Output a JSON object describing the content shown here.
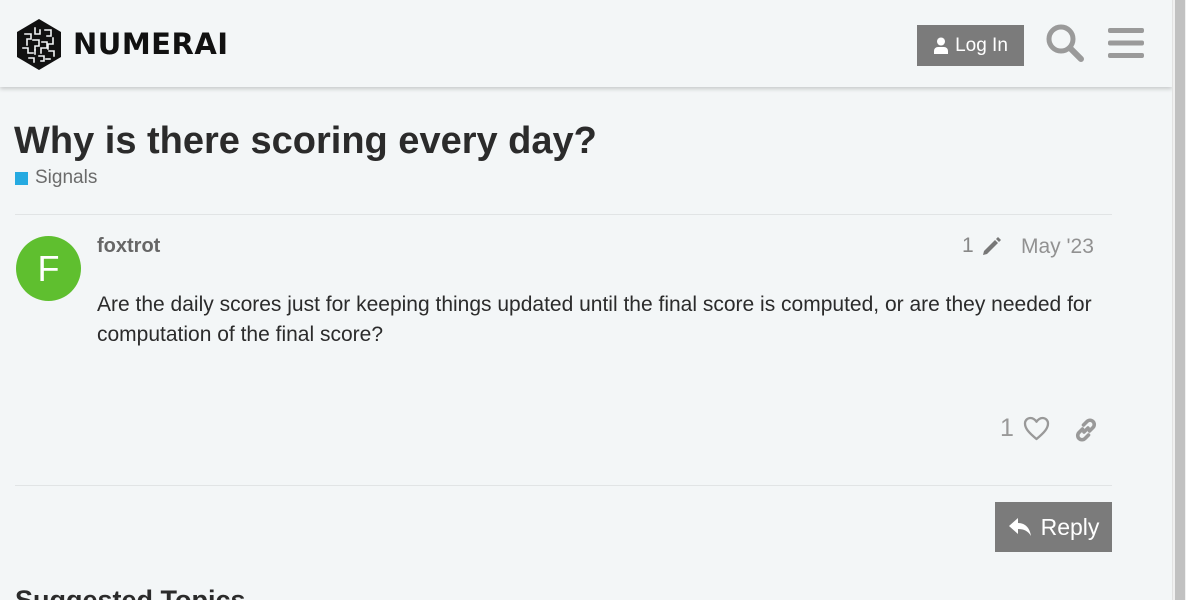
{
  "header": {
    "logo_text": "NUMERAI",
    "login_label": "Log In",
    "icons": {
      "login": "user-icon",
      "search": "search-icon",
      "menu": "hamburger-menu-icon"
    }
  },
  "topic": {
    "title": "Why is there scoring every day?",
    "category": {
      "name": "Signals",
      "color": "#25aae1"
    }
  },
  "post": {
    "avatar_letter": "F",
    "avatar_color": "#5fbf2f",
    "username": "foxtrot",
    "edit_count": "1",
    "date": "May '23",
    "body": "Are the daily scores just for keeping things updated until the final score is computed, or are they needed for computation of the final score?",
    "likes": "1",
    "icons": {
      "edit": "pencil-icon",
      "like": "heart-icon",
      "share": "link-icon"
    }
  },
  "actions": {
    "reply_label": "Reply",
    "reply_icon": "reply-icon"
  },
  "suggested": {
    "heading": "Suggested Topics"
  },
  "colors": {
    "background": "#f3f6f7",
    "button": "#7b7b7b",
    "text": "#2b2b2b"
  }
}
